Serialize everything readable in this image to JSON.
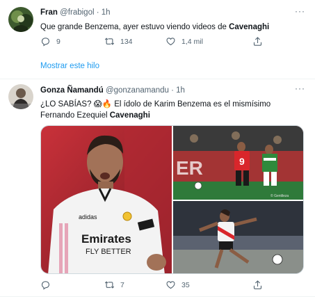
{
  "tweets": [
    {
      "display_name": "Fran",
      "handle": "@frabigol",
      "dot": "·",
      "time": "1h",
      "text_plain": "Que grande Benzema, ayer estuvo viendo videos de ",
      "text_bold": "Cavenaghi",
      "reply_count": "9",
      "retweet_count": "134",
      "like_count": "1,4 mil",
      "more_label": "···"
    },
    {
      "display_name": "Gonza Ñamandú",
      "handle": "@gonzanamandu",
      "dot": "·",
      "time": "1h",
      "text_plain": "¿LO SABÍAS? 😱🔥 El ídolo de Karim Benzema es el mismísimo Fernando Ezequiel ",
      "text_bold": "Cavenaghi",
      "reply_count": "",
      "retweet_count": "7",
      "like_count": "35",
      "more_label": "···",
      "photos": [
        {
          "alt": "Karim Benzema celebrating in Real Madrid white jersey",
          "sponsor": "Emirates",
          "sponsor_sub": "FLY BETTER"
        },
        {
          "alt": "Football players on pitch, red and green jerseys",
          "jersey_number": "9",
          "watermark": "© Gentileza"
        },
        {
          "alt": "Player in River Plate jersey kicking a ball"
        }
      ]
    }
  ],
  "show_thread_label": "Mostrar este hilo",
  "colors": {
    "accent": "#1d9bf0",
    "secondary_text": "#536471",
    "primary_text": "#0f1419",
    "divider": "#eff3f4"
  },
  "icons": [
    "more-icon",
    "reply-icon",
    "retweet-icon",
    "like-icon",
    "share-icon"
  ]
}
